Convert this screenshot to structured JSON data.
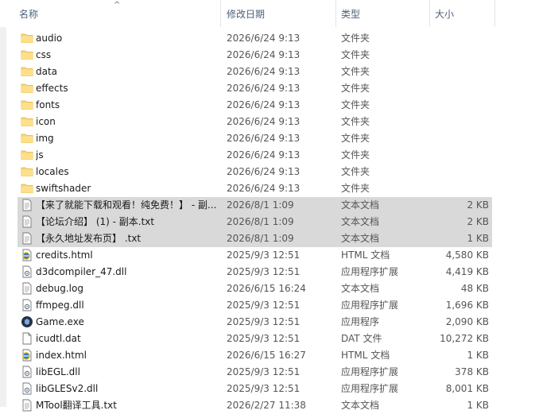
{
  "columns": {
    "name": "名称",
    "date": "修改日期",
    "type": "类型",
    "size": "大小"
  },
  "rows": [
    {
      "name": "audio",
      "date": "2026/6/24 9:13",
      "type": "文件夹",
      "size": "",
      "icon": "folder-icon"
    },
    {
      "name": "css",
      "date": "2026/6/24 9:13",
      "type": "文件夹",
      "size": "",
      "icon": "folder-icon"
    },
    {
      "name": "data",
      "date": "2026/6/24 9:13",
      "type": "文件夹",
      "size": "",
      "icon": "folder-icon"
    },
    {
      "name": "effects",
      "date": "2026/6/24 9:13",
      "type": "文件夹",
      "size": "",
      "icon": "folder-icon"
    },
    {
      "name": "fonts",
      "date": "2026/6/24 9:13",
      "type": "文件夹",
      "size": "",
      "icon": "folder-icon"
    },
    {
      "name": "icon",
      "date": "2026/6/24 9:13",
      "type": "文件夹",
      "size": "",
      "icon": "folder-icon"
    },
    {
      "name": "img",
      "date": "2026/6/24 9:13",
      "type": "文件夹",
      "size": "",
      "icon": "folder-icon"
    },
    {
      "name": "js",
      "date": "2026/6/24 9:13",
      "type": "文件夹",
      "size": "",
      "icon": "folder-icon"
    },
    {
      "name": "locales",
      "date": "2026/6/24 9:13",
      "type": "文件夹",
      "size": "",
      "icon": "folder-icon"
    },
    {
      "name": "swiftshader",
      "date": "2026/6/24 9:13",
      "type": "文件夹",
      "size": "",
      "icon": "folder-icon"
    },
    {
      "name": "【来了就能下载和观看！纯免费！】 - 副...",
      "date": "2026/8/1 1:09",
      "type": "文本文档",
      "size": "2 KB",
      "icon": "text-file-icon",
      "selected": true
    },
    {
      "name": "【论坛介绍】 (1) - 副本.txt",
      "date": "2026/8/1 1:09",
      "type": "文本文档",
      "size": "2 KB",
      "icon": "text-file-icon",
      "selected": true
    },
    {
      "name": "【永久地址发布页】 .txt",
      "date": "2026/8/1 1:09",
      "type": "文本文档",
      "size": "1 KB",
      "icon": "text-file-icon",
      "selected": true
    },
    {
      "name": "credits.html",
      "date": "2025/9/3 12:51",
      "type": "HTML 文档",
      "size": "4,580 KB",
      "icon": "html-file-icon"
    },
    {
      "name": "d3dcompiler_47.dll",
      "date": "2025/9/3 12:51",
      "type": "应用程序扩展",
      "size": "4,419 KB",
      "icon": "dll-file-icon"
    },
    {
      "name": "debug.log",
      "date": "2026/6/15 16:24",
      "type": "文本文档",
      "size": "48 KB",
      "icon": "text-file-icon"
    },
    {
      "name": "ffmpeg.dll",
      "date": "2025/9/3 12:51",
      "type": "应用程序扩展",
      "size": "1,696 KB",
      "icon": "dll-file-icon"
    },
    {
      "name": "Game.exe",
      "date": "2025/9/3 12:51",
      "type": "应用程序",
      "size": "2,090 KB",
      "icon": "exe-icon"
    },
    {
      "name": "icudtl.dat",
      "date": "2025/9/3 12:51",
      "type": "DAT 文件",
      "size": "10,272 KB",
      "icon": "blank-file-icon"
    },
    {
      "name": "index.html",
      "date": "2026/6/15 16:27",
      "type": "HTML 文档",
      "size": "1 KB",
      "icon": "html-file-icon"
    },
    {
      "name": "libEGL.dll",
      "date": "2025/9/3 12:51",
      "type": "应用程序扩展",
      "size": "378 KB",
      "icon": "dll-file-icon"
    },
    {
      "name": "libGLESv2.dll",
      "date": "2025/9/3 12:51",
      "type": "应用程序扩展",
      "size": "8,001 KB",
      "icon": "dll-file-icon"
    },
    {
      "name": "MTool翻译工具.txt",
      "date": "2026/2/27 11:38",
      "type": "文本文档",
      "size": "1 KB",
      "icon": "text-file-icon"
    }
  ]
}
